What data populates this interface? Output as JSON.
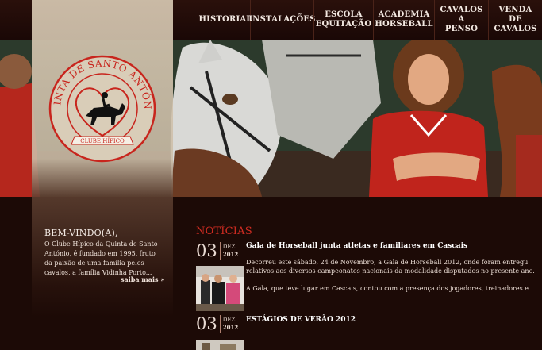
{
  "nav": {
    "items": [
      {
        "label": "HISTORIAL"
      },
      {
        "label": "INSTALAÇÕES"
      },
      {
        "label": "ESCOLA\nEQUITAÇÃO"
      },
      {
        "label": "ACADEMIA\nHORSEBALL"
      },
      {
        "label": "CAVALOS A\nPENSO"
      },
      {
        "label": "VENDA DE\nCAVALOS"
      }
    ]
  },
  "logo": {
    "top_text": "QUINTA DE SANTO ANTÓNIO",
    "banner_text": "CLUBE HÍPICO",
    "colors": {
      "ring": "#c8251d",
      "fill": "#d7cbb6"
    }
  },
  "welcome": {
    "title": "BEM-VINDO(A),",
    "text": "O Clube Hípico da Quinta de Santo António, é fundado em 1995, fruto da paixão de uma família pelos cavalos, a família Vidinha Porto...",
    "more": "saiba mais »"
  },
  "news": {
    "heading": "NOTÍCIAS",
    "items": [
      {
        "day": "03",
        "month": "DEZ",
        "year": "2012",
        "headline": "Gala de Horseball junta atletas e familiares em Cascais",
        "body1": "Decorreu este sábado, 24 de Novembro, a Gala de Horseball 2012, onde foram entregu",
        "body2": "relativos aos diversos campeonatos nacionais da modalidade disputados no presente ano.",
        "body3": "A Gala, que teve lugar em Cascais, contou com a presença dos jogadores, treinadores e"
      },
      {
        "day": "03",
        "month": "DEZ",
        "year": "2012",
        "headline": "ESTÁGIOS DE VERÃO 2012"
      }
    ]
  },
  "colors": {
    "background": "#1c0a06",
    "accent_red": "#d02c22",
    "nav_text": "#f3e9e2"
  }
}
